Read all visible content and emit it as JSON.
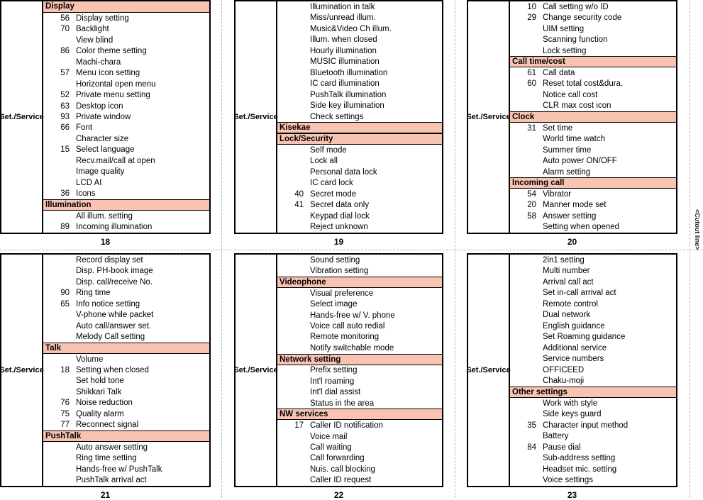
{
  "meta": {
    "cutout_line_label": "<Cutout line>",
    "category_label": "Set./\nService",
    "header_color": "#f9c3b2",
    "border_color": "#000000",
    "guide_color": "#b5b5b5"
  },
  "panels": [
    {
      "id": "panel-18",
      "page_number": "18",
      "category": "Set./Service",
      "rows": [
        {
          "type": "header",
          "num": "",
          "label": "Display"
        },
        {
          "type": "item",
          "num": "56",
          "label": "Display setting"
        },
        {
          "type": "item",
          "num": "70",
          "label": "Backlight"
        },
        {
          "type": "item",
          "num": "",
          "label": "View blind"
        },
        {
          "type": "item",
          "num": "86",
          "label": "Color theme setting"
        },
        {
          "type": "item",
          "num": "",
          "label": "Machi-chara"
        },
        {
          "type": "item",
          "num": "57",
          "label": "Menu icon setting"
        },
        {
          "type": "item",
          "num": "",
          "label": "Horizontal open menu"
        },
        {
          "type": "item",
          "num": "52",
          "label": "Private menu setting"
        },
        {
          "type": "item",
          "num": "63",
          "label": "Desktop icon"
        },
        {
          "type": "item",
          "num": "93",
          "label": "Private window"
        },
        {
          "type": "item",
          "num": "66",
          "label": "Font"
        },
        {
          "type": "item",
          "num": "",
          "label": "Character size"
        },
        {
          "type": "item",
          "num": "15",
          "label": "Select language"
        },
        {
          "type": "item",
          "num": "",
          "label": "Recv.mail/call at open"
        },
        {
          "type": "item",
          "num": "",
          "label": "Image quality"
        },
        {
          "type": "item",
          "num": "",
          "label": "LCD AI"
        },
        {
          "type": "item",
          "num": "36",
          "label": "Icons"
        },
        {
          "type": "header",
          "num": "",
          "label": "Illumination"
        },
        {
          "type": "item",
          "num": "",
          "label": "All illum. setting"
        },
        {
          "type": "item",
          "num": "89",
          "label": "Incoming illumination"
        }
      ]
    },
    {
      "id": "panel-19",
      "page_number": "19",
      "category": "Set./Service",
      "rows": [
        {
          "type": "item",
          "num": "",
          "label": "Illumination in talk"
        },
        {
          "type": "item",
          "num": "",
          "label": "Miss/unread illum."
        },
        {
          "type": "item",
          "num": "",
          "label": "Music&Video Ch illum."
        },
        {
          "type": "item",
          "num": "",
          "label": "Illum. when closed"
        },
        {
          "type": "item",
          "num": "",
          "label": "Hourly illumination"
        },
        {
          "type": "item",
          "num": "",
          "label": "MUSIC illumination"
        },
        {
          "type": "item",
          "num": "",
          "label": "Bluetooth illumination"
        },
        {
          "type": "item",
          "num": "",
          "label": "IC card illumination"
        },
        {
          "type": "item",
          "num": "",
          "label": "PushTalk illumination"
        },
        {
          "type": "item",
          "num": "",
          "label": "Side key illumination"
        },
        {
          "type": "item",
          "num": "",
          "label": "Check settings"
        },
        {
          "type": "header",
          "num": "",
          "label": "Kisekae"
        },
        {
          "type": "header",
          "num": "",
          "label": "Lock/Security"
        },
        {
          "type": "item",
          "num": "",
          "label": "Self mode"
        },
        {
          "type": "item",
          "num": "",
          "label": "Lock all"
        },
        {
          "type": "item",
          "num": "",
          "label": "Personal data lock"
        },
        {
          "type": "item",
          "num": "",
          "label": "IC card lock"
        },
        {
          "type": "item",
          "num": "40",
          "label": "Secret mode"
        },
        {
          "type": "item",
          "num": "41",
          "label": "Secret data only"
        },
        {
          "type": "item",
          "num": "",
          "label": "Keypad dial lock"
        },
        {
          "type": "item",
          "num": "",
          "label": "Reject unknown"
        }
      ]
    },
    {
      "id": "panel-20",
      "page_number": "20",
      "category": "Set./Service",
      "rows": [
        {
          "type": "item",
          "num": "10",
          "label": "Call setting w/o ID"
        },
        {
          "type": "item",
          "num": "29",
          "label": "Change security code"
        },
        {
          "type": "item",
          "num": "",
          "label": "UIM setting"
        },
        {
          "type": "item",
          "num": "",
          "label": "Scanning function"
        },
        {
          "type": "item",
          "num": "",
          "label": "Lock setting"
        },
        {
          "type": "header",
          "num": "",
          "label": "Call time/cost"
        },
        {
          "type": "item",
          "num": "61",
          "label": "Call data"
        },
        {
          "type": "item",
          "num": "60",
          "label": "Reset total cost&dura."
        },
        {
          "type": "item",
          "num": "",
          "label": "Notice call cost"
        },
        {
          "type": "item",
          "num": "",
          "label": "CLR max cost icon"
        },
        {
          "type": "header",
          "num": "",
          "label": "Clock"
        },
        {
          "type": "item",
          "num": "31",
          "label": "Set time"
        },
        {
          "type": "item",
          "num": "",
          "label": "World time watch"
        },
        {
          "type": "item",
          "num": "",
          "label": "Summer time"
        },
        {
          "type": "item",
          "num": "",
          "label": "Auto power ON/OFF"
        },
        {
          "type": "item",
          "num": "",
          "label": "Alarm setting"
        },
        {
          "type": "header",
          "num": "",
          "label": "Incoming call"
        },
        {
          "type": "item",
          "num": "54",
          "label": "Vibrator"
        },
        {
          "type": "item",
          "num": "20",
          "label": "Manner mode set"
        },
        {
          "type": "item",
          "num": "58",
          "label": "Answer setting"
        },
        {
          "type": "item",
          "num": "",
          "label": "Setting when opened"
        }
      ]
    },
    {
      "id": "panel-21",
      "page_number": "21",
      "category": "Set./Service",
      "rows": [
        {
          "type": "item",
          "num": "",
          "label": "Record display set"
        },
        {
          "type": "item",
          "num": "",
          "label": "Disp. PH-book image"
        },
        {
          "type": "item",
          "num": "",
          "label": "Disp. call/receive No."
        },
        {
          "type": "item",
          "num": "90",
          "label": "Ring time"
        },
        {
          "type": "item",
          "num": "65",
          "label": "Info notice setting"
        },
        {
          "type": "item",
          "num": "",
          "label": "V-phone while packet"
        },
        {
          "type": "item",
          "num": "",
          "label": "Auto call/answer set."
        },
        {
          "type": "item",
          "num": "",
          "label": "Melody Call setting"
        },
        {
          "type": "header",
          "num": "",
          "label": "Talk"
        },
        {
          "type": "item",
          "num": "",
          "label": "Volume"
        },
        {
          "type": "item",
          "num": "18",
          "label": "Setting when closed"
        },
        {
          "type": "item",
          "num": "",
          "label": "Set hold tone"
        },
        {
          "type": "item",
          "num": "",
          "label": "Shikkari Talk"
        },
        {
          "type": "item",
          "num": "76",
          "label": "Noise reduction"
        },
        {
          "type": "item",
          "num": "75",
          "label": "Quality alarm"
        },
        {
          "type": "item",
          "num": "77",
          "label": "Reconnect signal"
        },
        {
          "type": "header",
          "num": "",
          "label": "PushTalk"
        },
        {
          "type": "item",
          "num": "",
          "label": "Auto answer setting"
        },
        {
          "type": "item",
          "num": "",
          "label": "Ring time setting"
        },
        {
          "type": "item",
          "num": "",
          "label": "Hands-free w/ PushTalk"
        },
        {
          "type": "item",
          "num": "",
          "label": "PushTalk arrival act"
        }
      ]
    },
    {
      "id": "panel-22",
      "page_number": "22",
      "category": "Set./Service",
      "rows": [
        {
          "type": "item",
          "num": "",
          "label": "Sound setting"
        },
        {
          "type": "item",
          "num": "",
          "label": "Vibration setting"
        },
        {
          "type": "header",
          "num": "",
          "label": "Videophone"
        },
        {
          "type": "item",
          "num": "",
          "label": "Visual preference"
        },
        {
          "type": "item",
          "num": "",
          "label": "Select image"
        },
        {
          "type": "item",
          "num": "",
          "label": "Hands-free w/ V. phone"
        },
        {
          "type": "item",
          "num": "",
          "label": "Voice call auto redial"
        },
        {
          "type": "item",
          "num": "",
          "label": "Remote monitoring"
        },
        {
          "type": "item",
          "num": "",
          "label": "Notify switchable mode"
        },
        {
          "type": "header",
          "num": "",
          "label": "Network setting"
        },
        {
          "type": "item",
          "num": "",
          "label": "Prefix setting"
        },
        {
          "type": "item",
          "num": "",
          "label": "Int'l roaming"
        },
        {
          "type": "item",
          "num": "",
          "label": "Int'l dial assist"
        },
        {
          "type": "item",
          "num": "",
          "label": "Status in the area"
        },
        {
          "type": "header",
          "num": "",
          "label": "NW services"
        },
        {
          "type": "item",
          "num": "17",
          "label": "Caller ID notification"
        },
        {
          "type": "item",
          "num": "",
          "label": "Voice mail"
        },
        {
          "type": "item",
          "num": "",
          "label": "Call waiting"
        },
        {
          "type": "item",
          "num": "",
          "label": "Call forwarding"
        },
        {
          "type": "item",
          "num": "",
          "label": "Nuis. call blocking"
        },
        {
          "type": "item",
          "num": "",
          "label": "Caller ID request"
        }
      ]
    },
    {
      "id": "panel-23",
      "page_number": "23",
      "category": "Set./Service",
      "rows": [
        {
          "type": "item",
          "num": "",
          "label": "2in1 setting"
        },
        {
          "type": "item",
          "num": "",
          "label": "Multi number"
        },
        {
          "type": "item",
          "num": "",
          "label": "Arrival call act"
        },
        {
          "type": "item",
          "num": "",
          "label": "Set in-call arrival act"
        },
        {
          "type": "item",
          "num": "",
          "label": "Remote control"
        },
        {
          "type": "item",
          "num": "",
          "label": "Dual network"
        },
        {
          "type": "item",
          "num": "",
          "label": "English guidance"
        },
        {
          "type": "item",
          "num": "",
          "label": "Set Roaming guidance"
        },
        {
          "type": "item",
          "num": "",
          "label": "Additional service"
        },
        {
          "type": "item",
          "num": "",
          "label": "Service numbers"
        },
        {
          "type": "item",
          "num": "",
          "label": "OFFICEED"
        },
        {
          "type": "item",
          "num": "",
          "label": "Chaku-moji"
        },
        {
          "type": "header",
          "num": "",
          "label": "Other settings"
        },
        {
          "type": "item",
          "num": "",
          "label": "Work with style"
        },
        {
          "type": "item",
          "num": "",
          "label": "Side keys guard"
        },
        {
          "type": "item",
          "num": "35",
          "label": "Character input method"
        },
        {
          "type": "item",
          "num": "",
          "label": "Battery"
        },
        {
          "type": "item",
          "num": "84",
          "label": "Pause dial"
        },
        {
          "type": "item",
          "num": "",
          "label": "Sub-address setting"
        },
        {
          "type": "item",
          "num": "",
          "label": "Headset mic. setting"
        },
        {
          "type": "item",
          "num": "",
          "label": "Voice settings"
        }
      ]
    }
  ]
}
